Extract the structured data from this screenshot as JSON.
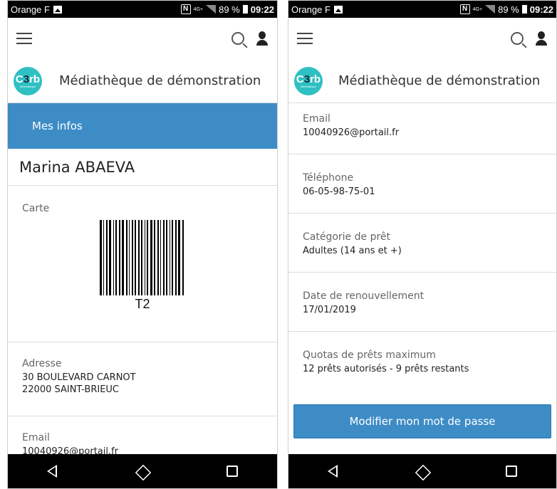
{
  "status": {
    "carrier": "Orange F",
    "network": "4G+",
    "battery": "89 %",
    "time": "09:22"
  },
  "brand": {
    "logo_mark": "C3rb",
    "logo_sub": "informatique",
    "name": "Médiathèque de démonstration"
  },
  "left": {
    "tab_label": "Mes infos",
    "user_name": "Marina ABAEVA",
    "card_label": "Carte",
    "barcode_text": "T2",
    "address_label": "Adresse",
    "address_line1": "30 BOULEVARD CARNOT",
    "address_line2": "22000 SAINT-BRIEUC",
    "email_label": "Email",
    "email_value": "10040926@portail.fr"
  },
  "right": {
    "fields": [
      {
        "label": "Email",
        "value": "10040926@portail.fr"
      },
      {
        "label": "Téléphone",
        "value": "06-05-98-75-01"
      },
      {
        "label": "Catégorie de prêt",
        "value": "Adultes (14 ans et +)"
      },
      {
        "label": "Date de renouvellement",
        "value": "17/01/2019"
      },
      {
        "label": "Quotas de prêts maximum",
        "value": "12 prêts autorisés - 9 prêts restants"
      }
    ],
    "button_label": "Modifier mon mot de passe"
  },
  "icons": [
    "image-icon",
    "nfc-icon",
    "signal-icon",
    "battery-icon",
    "menu-icon",
    "search-icon",
    "user-icon",
    "back-icon",
    "home-icon",
    "recent-apps-icon"
  ],
  "colors": {
    "accent": "#3d8cc6",
    "logo": "#2fc0c2",
    "statusbar": "#000000"
  }
}
